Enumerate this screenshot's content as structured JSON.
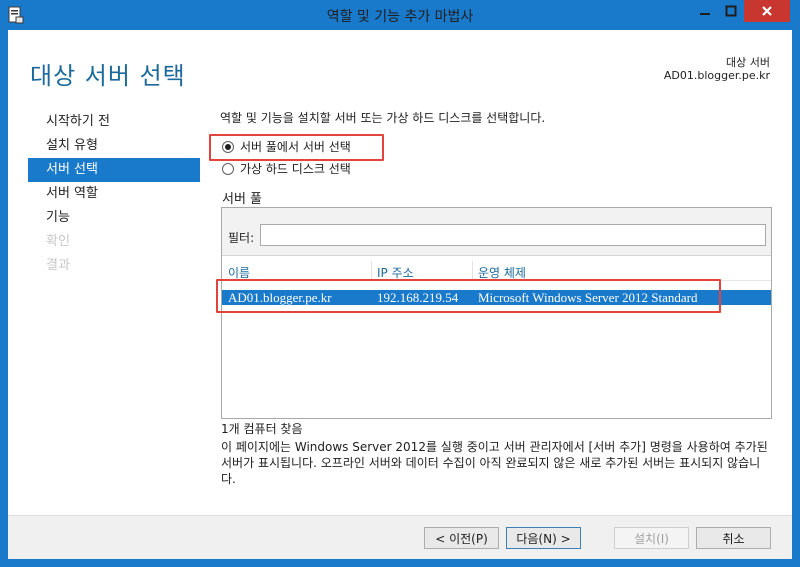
{
  "window": {
    "title": "역할 및 기능 추가 마법사",
    "accent": "#1979ca",
    "close_color": "#c7372f"
  },
  "header": {
    "page_title": "대상 서버 선택",
    "destination_label": "대상 서버",
    "destination_server": "AD01.blogger.pe.kr"
  },
  "nav": {
    "items": [
      {
        "label": "시작하기 전",
        "state": "normal"
      },
      {
        "label": "설치 유형",
        "state": "normal"
      },
      {
        "label": "서버 선택",
        "state": "active"
      },
      {
        "label": "서버 역할",
        "state": "normal"
      },
      {
        "label": "기능",
        "state": "normal"
      },
      {
        "label": "확인",
        "state": "disabled"
      },
      {
        "label": "결과",
        "state": "disabled"
      }
    ]
  },
  "main": {
    "intro": "역할 및 기능을 설치할 서버 또는 가상 하드 디스크를 선택합니다.",
    "options": [
      {
        "label": "서버 풀에서 서버 선택",
        "checked": true
      },
      {
        "label": "가상 하드 디스크 선택",
        "checked": false
      }
    ],
    "pool_title": "서버 풀",
    "filter_label": "필터:",
    "filter_value": "",
    "columns": [
      "이름",
      "IP 주소",
      "운영 체제"
    ],
    "rows": [
      {
        "name": "AD01.blogger.pe.kr",
        "ip": "192.168.219.54",
        "os": "Microsoft Windows Server 2012 Standard",
        "selected": true
      }
    ],
    "count_text": "1개 컴퓨터 찾음",
    "note": "이 페이지에는 Windows Server 2012를 실행 중이고 서버 관리자에서 [서버 추가] 명령을 사용하여 추가된 서버가 표시됩니다. 오프라인 서버와 데이터 수집이 아직 완료되지 않은 새로 추가된 서버는 표시되지 않습니다."
  },
  "footer": {
    "prev_label": "< 이전(P)",
    "next_label": "다음(N) >",
    "install_label": "설치(I)",
    "cancel_label": "취소"
  },
  "highlight_color": "#e0443c"
}
